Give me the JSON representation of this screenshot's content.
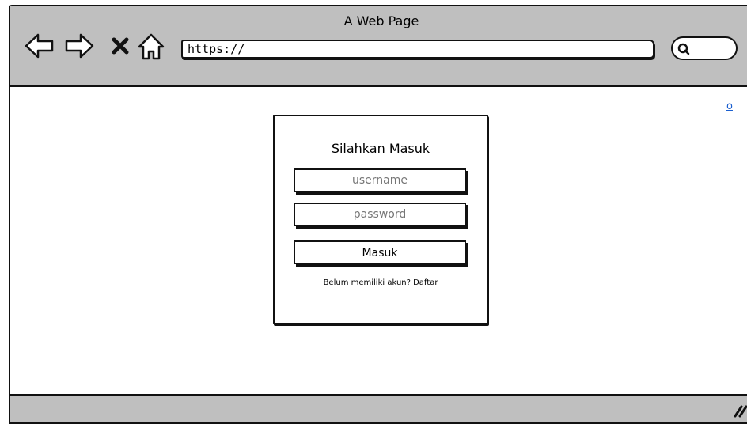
{
  "window": {
    "title": "A Web Page"
  },
  "browser": {
    "url": "https://",
    "nav_icons": [
      "back-arrow-icon",
      "forward-arrow-icon",
      "close-x-icon",
      "home-icon"
    ],
    "search_icon": "search-icon"
  },
  "page": {
    "corner_link": "o",
    "login": {
      "title": "Silahkan Masuk",
      "username_placeholder": "username",
      "password_placeholder": "password",
      "submit_label": "Masuk",
      "signup_text": "Belum memiliki akun? Daftar"
    }
  },
  "colors": {
    "chrome": "#bfbfbf",
    "outline": "#111111",
    "link": "#1a5fcf"
  }
}
